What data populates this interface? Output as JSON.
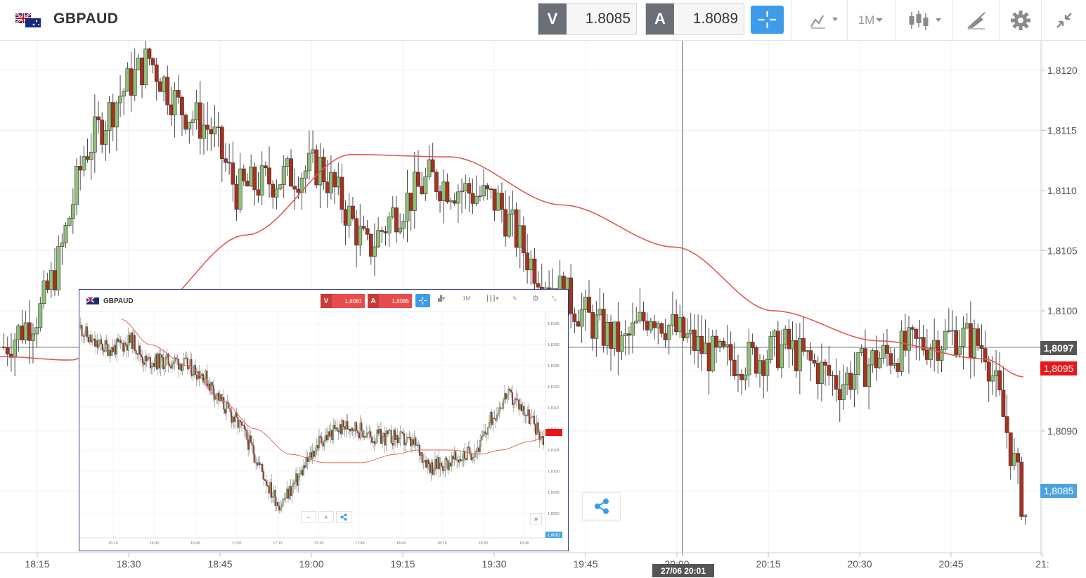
{
  "header": {
    "symbol": "GBPAUD",
    "sell": {
      "label": "V",
      "value": "1.8085"
    },
    "buy": {
      "label": "A",
      "value": "1.8089"
    },
    "interval": "1M"
  },
  "main_chart": {
    "price_labels": [
      "1,8120",
      "1,8115",
      "1,8110",
      "1,8105",
      "1,8100",
      "1,8095",
      "1,8090",
      "1,8085"
    ],
    "time_labels": [
      "18:15",
      "18:30",
      "18:45",
      "19:00",
      "19:15",
      "19:30",
      "19:45",
      "20:00",
      "20:15",
      "20:30",
      "20:45",
      "21:"
    ],
    "crosshair_price": "1,8097",
    "current_price_tag": "1,8095",
    "bid_price_tag": "1,8085",
    "crosshair_time": "27/06 20:01",
    "colors": {
      "up": "#8fbf7a",
      "down": "#a8321f",
      "ma": "#e05a52",
      "accent": "#3d9be9",
      "tag_red": "#e8161b"
    }
  },
  "inset": {
    "symbol": "GBPAUD",
    "sell": {
      "label": "V",
      "value": "1,8081"
    },
    "buy": {
      "label": "A",
      "value": "1,8085"
    },
    "interval": "1M",
    "price_labels": [
      "1,8135",
      "1,8130",
      "1,8125",
      "1,8120",
      "1,8115",
      "1,8110",
      "1,8105",
      "1,8100",
      "1,8095",
      "1,8090"
    ],
    "time_labels": [
      "16:15",
      "16:30",
      "16:45",
      "17:00",
      "17:15",
      "17:30",
      "17:45",
      "18:00",
      "18:15",
      "18:30",
      "18:45"
    ],
    "price_tag": "1,8081",
    "zoom_minus": "−",
    "zoom_plus": "+",
    "more_label": "»"
  }
}
